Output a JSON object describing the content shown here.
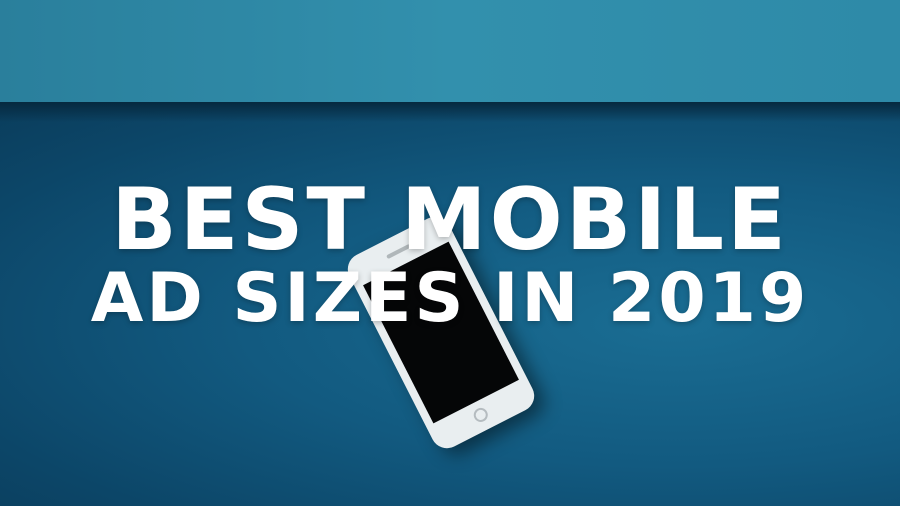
{
  "headline": {
    "line1": "BEST MOBILE",
    "line2": "AD SIZES IN 2019"
  },
  "colors": {
    "top_band": "#3290ad",
    "background": "#0c4668",
    "text": "#ffffff"
  }
}
